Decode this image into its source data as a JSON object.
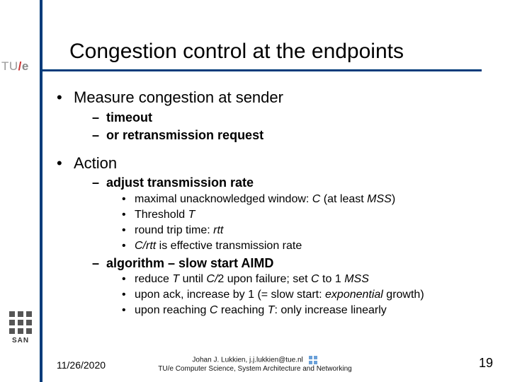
{
  "logo": {
    "tue_prefix": "TU",
    "tue_slash": "/",
    "tue_e": "e",
    "san": "SAN"
  },
  "title": "Congestion control at the endpoints",
  "body": {
    "b1a": "Measure congestion at sender",
    "b1a_s1": "timeout",
    "b1a_s2": "or retransmission request",
    "b1b": "Action",
    "b1b_s1": "adjust transmission rate",
    "b1b_s1_i1_pre": "maximal unacknowledged window: ",
    "b1b_s1_i1_c": "C",
    "b1b_s1_i1_mid": " (at least ",
    "b1b_s1_i1_mss": "MSS",
    "b1b_s1_i1_end": ")",
    "b1b_s1_i2_pre": "Threshold ",
    "b1b_s1_i2_t": "T",
    "b1b_s1_i3_pre": "round trip time: ",
    "b1b_s1_i3_rtt": "rtt",
    "b1b_s1_i4_a": "C/rtt",
    "b1b_s1_i4_b": " is effective transmission rate",
    "b1b_s2": "algorithm – slow start AIMD",
    "b1b_s2_i1_a": "reduce ",
    "b1b_s2_i1_t": "T",
    "b1b_s2_i1_b": " until  ",
    "b1b_s2_i1_c": "C/",
    "b1b_s2_i1_d": "2 upon failure; set ",
    "b1b_s2_i1_e": "C ",
    "b1b_s2_i1_f": " to 1 ",
    "b1b_s2_i1_g": "MSS",
    "b1b_s2_i2_a": "upon ack, increase by 1 (= slow start: ",
    "b1b_s2_i2_b": "exponential",
    "b1b_s2_i2_c": " growth)",
    "b1b_s2_i3_a": "upon reaching ",
    "b1b_s2_i3_b": "C",
    "b1b_s2_i3_c": " reaching ",
    "b1b_s2_i3_d": "T",
    "b1b_s2_i3_e": ": only increase linearly"
  },
  "footer": {
    "date": "11/26/2020",
    "line1": "Johan J. Lukkien, j.j.lukkien@tue.nl",
    "line2": "TU/e Computer Science, System Architecture and Networking",
    "page": "19"
  }
}
